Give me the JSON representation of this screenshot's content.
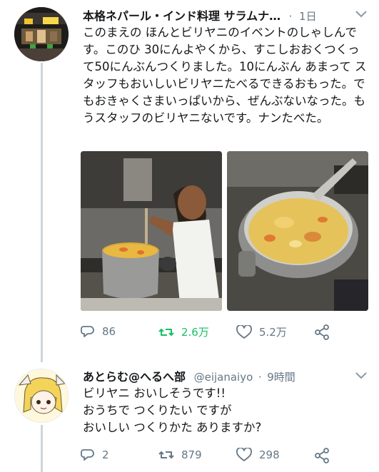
{
  "tweet1": {
    "author_name": "本格ネパール・インド料理 サラムナ…",
    "separator": "·",
    "time": "1日",
    "text": "このまえの ほんとビリヤニのイベントのしゃしんです。このひ 30にんよやくから、すこしおおくつくって50にんぶんつくりました。10にんぶん あまって スタッフもおいしいビリヤニたべるできるおもった。でもおきゃくさまいっぱいから、ぜんぶないなった。もうスタッフのビリヤニないです。ナンたべた。",
    "replies": "86",
    "retweets": "2.6万",
    "likes": "5.2万"
  },
  "tweet2": {
    "author_name": "あとらむ@へるへ部",
    "handle": "@eijanaiyo",
    "separator": "·",
    "time": "9時間",
    "line1": "ビリヤニ おいしそうです!!",
    "line2": "おうちで つくりたい ですが",
    "line3": "おいしい つくりかた ありますか?",
    "replies": "2",
    "retweets": "879",
    "likes": "298"
  },
  "colors": {
    "meta": "#657786",
    "retweet_active": "#17bf63",
    "divider": "#e6ecf0",
    "thread_line": "#ccd6dd"
  },
  "icons": [
    "reply-icon",
    "retweet-icon",
    "like-icon",
    "share-icon",
    "chevron-down-icon"
  ]
}
